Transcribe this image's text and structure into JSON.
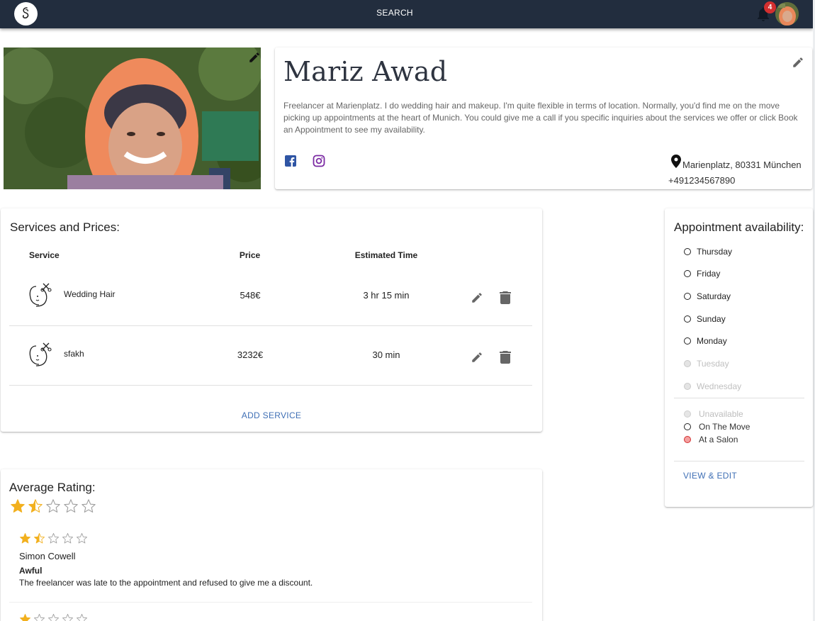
{
  "header": {
    "search_label": "SEARCH",
    "notification_count": "4"
  },
  "profile": {
    "name": "Mariz Awad",
    "bio": "Freelancer at Marienplatz. I do wedding hair and makeup. I'm quite flexible in terms of location. Normally, you'd find me on the move picking up appointments at the heart of Munich. You could give me a call if you specific inquiries about the services we offer or click Book an Appointment to see my availability.",
    "address": "Marienplatz, 80331 München",
    "phone": "+491234567890"
  },
  "services": {
    "title": "Services and Prices:",
    "columns": {
      "service": "Service",
      "price": "Price",
      "time": "Estimated Time"
    },
    "rows": [
      {
        "name": "Wedding Hair",
        "price": "548€",
        "time": "3 hr 15 min"
      },
      {
        "name": "sfakh",
        "price": "3232€",
        "time": "30 min"
      }
    ],
    "add_label": "ADD SERVICE"
  },
  "rating": {
    "title": "Average Rating:",
    "average_stars": 1.5,
    "reviews": [
      {
        "stars": 1.5,
        "author": "Simon Cowell",
        "title": "Awful",
        "text": "The freelancer was late to the appointment and refused to give me a discount."
      },
      {
        "stars": 1
      }
    ]
  },
  "availability": {
    "title": "Appointment availability:",
    "days": [
      {
        "label": "Thursday",
        "enabled": true
      },
      {
        "label": "Friday",
        "enabled": true
      },
      {
        "label": "Saturday",
        "enabled": true
      },
      {
        "label": "Sunday",
        "enabled": true
      },
      {
        "label": "Monday",
        "enabled": true
      },
      {
        "label": "Tuesday",
        "enabled": false
      },
      {
        "label": "Wednesday",
        "enabled": false
      }
    ],
    "legend": {
      "unavailable": "Unavailable",
      "on_the_move": "On The Move",
      "at_salon": "At a Salon"
    },
    "view_edit_label": "VIEW & EDIT"
  },
  "colors": {
    "topbar": "#222d3e",
    "accent_link": "#3f6fb5",
    "star": "#f2b01e",
    "badge": "#d32f2f"
  }
}
